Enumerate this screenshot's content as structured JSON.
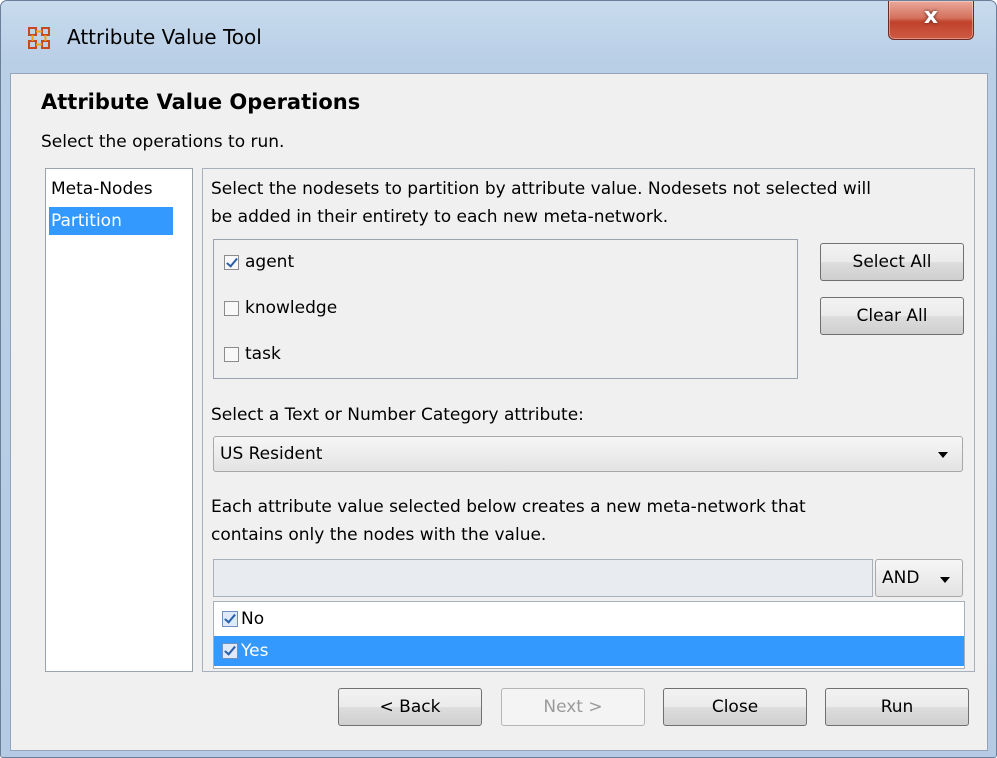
{
  "window": {
    "title": "Attribute Value Tool",
    "close_glyph": "x"
  },
  "header": {
    "title": "Attribute Value Operations",
    "subtitle": "Select the operations to run."
  },
  "operations": [
    {
      "label": "Meta-Nodes",
      "selected": false
    },
    {
      "label": "Partition",
      "selected": true
    }
  ],
  "partition": {
    "instructions_line1": "Select the nodesets to partition by attribute value. Nodesets not selected will",
    "instructions_line2": "be added in their entirety to each new meta-network.",
    "nodesets": [
      {
        "label": "agent",
        "checked": true
      },
      {
        "label": "knowledge",
        "checked": false
      },
      {
        "label": "task",
        "checked": false
      }
    ],
    "select_all_label": "Select All",
    "clear_all_label": "Clear All",
    "attribute_prompt": "Select a Text or Number Category attribute:",
    "attribute_selected": "US Resident",
    "values_prompt_line1": "Each attribute value selected below creates a new meta-network that",
    "values_prompt_line2": "contains only the nodes with the value.",
    "filter_text": "",
    "combine_mode": "AND",
    "values": [
      {
        "label": "No",
        "checked": true,
        "selected": false
      },
      {
        "label": "Yes",
        "checked": true,
        "selected": true
      }
    ]
  },
  "footer": {
    "back_label": "< Back",
    "next_label": "Next >",
    "close_label": "Close",
    "run_label": "Run"
  },
  "colors": {
    "selection": "#3399ff",
    "title_bar": "#b9cfe6",
    "close_button": "#c0422b"
  }
}
